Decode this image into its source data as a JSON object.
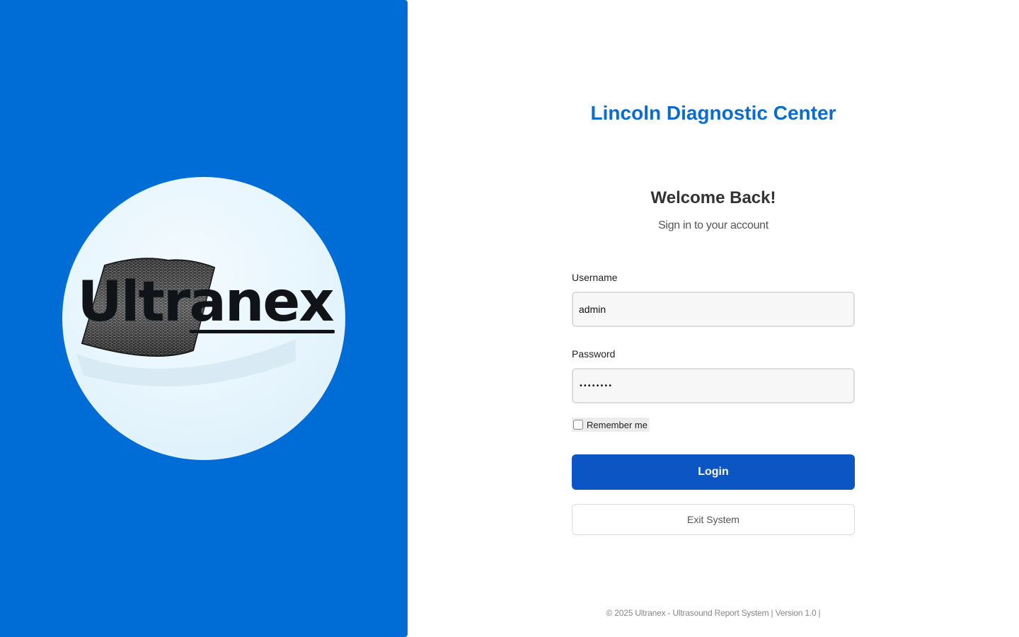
{
  "brand": {
    "logo_text": "Ultranex",
    "panel_color": "#006cd6"
  },
  "header": {
    "clinic_name": "Lincoln Diagnostic Center"
  },
  "welcome": {
    "title": "Welcome Back!",
    "subtitle": "Sign in to your account"
  },
  "form": {
    "username_label": "Username",
    "username_value": "admin",
    "password_label": "Password",
    "password_value": "••••••••",
    "remember_label": "Remember me",
    "remember_checked": false,
    "login_label": "Login",
    "exit_label": "Exit System"
  },
  "footer": {
    "text": "© 2025 Ultranex - Ultrasound Report System | Version 1.0 |"
  },
  "colors": {
    "accent": "#0a6bd0",
    "button": "#0b55c4"
  }
}
